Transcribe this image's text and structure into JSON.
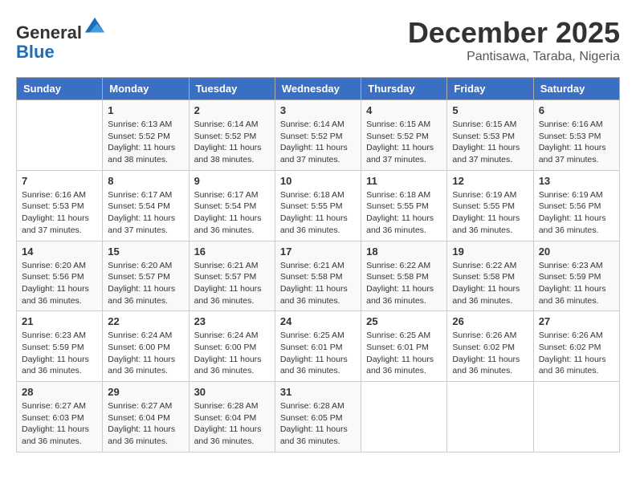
{
  "logo": {
    "general": "General",
    "blue": "Blue"
  },
  "header": {
    "month": "December 2025",
    "location": "Pantisawa, Taraba, Nigeria"
  },
  "weekdays": [
    "Sunday",
    "Monday",
    "Tuesday",
    "Wednesday",
    "Thursday",
    "Friday",
    "Saturday"
  ],
  "weeks": [
    [
      {
        "day": "",
        "info": ""
      },
      {
        "day": "1",
        "info": "Sunrise: 6:13 AM\nSunset: 5:52 PM\nDaylight: 11 hours and 38 minutes."
      },
      {
        "day": "2",
        "info": "Sunrise: 6:14 AM\nSunset: 5:52 PM\nDaylight: 11 hours and 38 minutes."
      },
      {
        "day": "3",
        "info": "Sunrise: 6:14 AM\nSunset: 5:52 PM\nDaylight: 11 hours and 37 minutes."
      },
      {
        "day": "4",
        "info": "Sunrise: 6:15 AM\nSunset: 5:52 PM\nDaylight: 11 hours and 37 minutes."
      },
      {
        "day": "5",
        "info": "Sunrise: 6:15 AM\nSunset: 5:53 PM\nDaylight: 11 hours and 37 minutes."
      },
      {
        "day": "6",
        "info": "Sunrise: 6:16 AM\nSunset: 5:53 PM\nDaylight: 11 hours and 37 minutes."
      }
    ],
    [
      {
        "day": "7",
        "info": "Sunrise: 6:16 AM\nSunset: 5:53 PM\nDaylight: 11 hours and 37 minutes."
      },
      {
        "day": "8",
        "info": "Sunrise: 6:17 AM\nSunset: 5:54 PM\nDaylight: 11 hours and 37 minutes."
      },
      {
        "day": "9",
        "info": "Sunrise: 6:17 AM\nSunset: 5:54 PM\nDaylight: 11 hours and 36 minutes."
      },
      {
        "day": "10",
        "info": "Sunrise: 6:18 AM\nSunset: 5:55 PM\nDaylight: 11 hours and 36 minutes."
      },
      {
        "day": "11",
        "info": "Sunrise: 6:18 AM\nSunset: 5:55 PM\nDaylight: 11 hours and 36 minutes."
      },
      {
        "day": "12",
        "info": "Sunrise: 6:19 AM\nSunset: 5:55 PM\nDaylight: 11 hours and 36 minutes."
      },
      {
        "day": "13",
        "info": "Sunrise: 6:19 AM\nSunset: 5:56 PM\nDaylight: 11 hours and 36 minutes."
      }
    ],
    [
      {
        "day": "14",
        "info": "Sunrise: 6:20 AM\nSunset: 5:56 PM\nDaylight: 11 hours and 36 minutes."
      },
      {
        "day": "15",
        "info": "Sunrise: 6:20 AM\nSunset: 5:57 PM\nDaylight: 11 hours and 36 minutes."
      },
      {
        "day": "16",
        "info": "Sunrise: 6:21 AM\nSunset: 5:57 PM\nDaylight: 11 hours and 36 minutes."
      },
      {
        "day": "17",
        "info": "Sunrise: 6:21 AM\nSunset: 5:58 PM\nDaylight: 11 hours and 36 minutes."
      },
      {
        "day": "18",
        "info": "Sunrise: 6:22 AM\nSunset: 5:58 PM\nDaylight: 11 hours and 36 minutes."
      },
      {
        "day": "19",
        "info": "Sunrise: 6:22 AM\nSunset: 5:58 PM\nDaylight: 11 hours and 36 minutes."
      },
      {
        "day": "20",
        "info": "Sunrise: 6:23 AM\nSunset: 5:59 PM\nDaylight: 11 hours and 36 minutes."
      }
    ],
    [
      {
        "day": "21",
        "info": "Sunrise: 6:23 AM\nSunset: 5:59 PM\nDaylight: 11 hours and 36 minutes."
      },
      {
        "day": "22",
        "info": "Sunrise: 6:24 AM\nSunset: 6:00 PM\nDaylight: 11 hours and 36 minutes."
      },
      {
        "day": "23",
        "info": "Sunrise: 6:24 AM\nSunset: 6:00 PM\nDaylight: 11 hours and 36 minutes."
      },
      {
        "day": "24",
        "info": "Sunrise: 6:25 AM\nSunset: 6:01 PM\nDaylight: 11 hours and 36 minutes."
      },
      {
        "day": "25",
        "info": "Sunrise: 6:25 AM\nSunset: 6:01 PM\nDaylight: 11 hours and 36 minutes."
      },
      {
        "day": "26",
        "info": "Sunrise: 6:26 AM\nSunset: 6:02 PM\nDaylight: 11 hours and 36 minutes."
      },
      {
        "day": "27",
        "info": "Sunrise: 6:26 AM\nSunset: 6:02 PM\nDaylight: 11 hours and 36 minutes."
      }
    ],
    [
      {
        "day": "28",
        "info": "Sunrise: 6:27 AM\nSunset: 6:03 PM\nDaylight: 11 hours and 36 minutes."
      },
      {
        "day": "29",
        "info": "Sunrise: 6:27 AM\nSunset: 6:04 PM\nDaylight: 11 hours and 36 minutes."
      },
      {
        "day": "30",
        "info": "Sunrise: 6:28 AM\nSunset: 6:04 PM\nDaylight: 11 hours and 36 minutes."
      },
      {
        "day": "31",
        "info": "Sunrise: 6:28 AM\nSunset: 6:05 PM\nDaylight: 11 hours and 36 minutes."
      },
      {
        "day": "",
        "info": ""
      },
      {
        "day": "",
        "info": ""
      },
      {
        "day": "",
        "info": ""
      }
    ]
  ]
}
